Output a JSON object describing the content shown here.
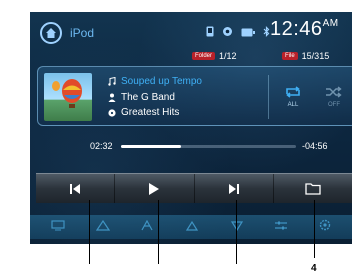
{
  "header": {
    "source": "iPod",
    "clock": "12:46",
    "clock_suffix": "AM",
    "folder_tag": "Folder",
    "folder_value": "1/12",
    "file_tag": "File",
    "file_value": "15/315"
  },
  "now_playing": {
    "title": "Souped up Tempo",
    "artist": "The G Band",
    "album": "Greatest Hits"
  },
  "modes": {
    "repeat_label": "ALL",
    "shuffle_label": "OFF"
  },
  "progress": {
    "elapsed": "02:32",
    "remaining": "-04:56",
    "fraction": 0.34
  },
  "callouts": {
    "number_4": "4"
  },
  "colors": {
    "accent": "#3fb0f5",
    "folder_tag_bg": "#b8212a"
  }
}
